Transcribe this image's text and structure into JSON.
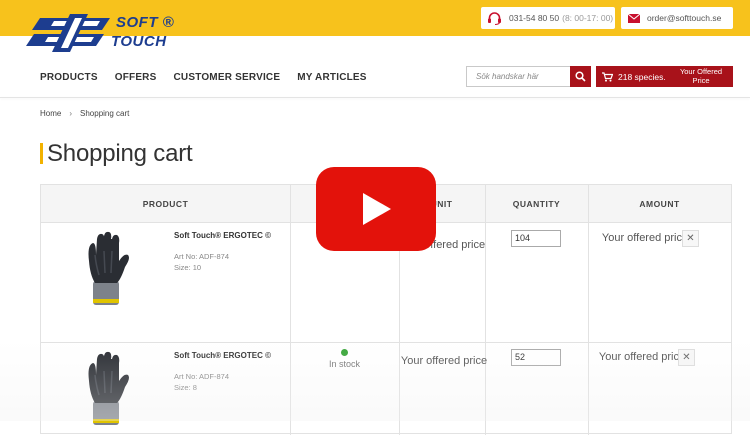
{
  "header": {
    "logo": {
      "line1": "SOFT ®",
      "line2": "TOUCH"
    },
    "phone": {
      "number": "031-54 80 50",
      "hours": "(8: 00-17: 00)"
    },
    "email": "order@softtouch.se"
  },
  "nav": {
    "items": [
      "PRODUCTS",
      "OFFERS",
      "CUSTOMER SERVICE",
      "MY ARTICLES"
    ]
  },
  "search": {
    "placeholder": "Sök handskar här"
  },
  "cart_button": {
    "label": "218 species.",
    "offer_label": "Your Offered Price"
  },
  "breadcrumb": {
    "home": "Home",
    "sep": "›",
    "current": "Shopping cart"
  },
  "page": {
    "title": "Shopping cart"
  },
  "table": {
    "headers": {
      "product": "PRODUCT",
      "unit": "UNIT",
      "quantity": "QUANTITY",
      "amount": "AMOUNT"
    },
    "rows": [
      {
        "name": "Soft Touch® ERGOTEC ©",
        "art_no": "Art No: ADF-874",
        "size": "Size: 10",
        "stock": "",
        "unit_price": "Your offered price",
        "quantity": "104",
        "amount": "Your offered price"
      },
      {
        "name": "Soft Touch® ERGOTEC ©",
        "art_no": "Art No: ADF-874",
        "size": "Size: 8",
        "stock": "In stock",
        "unit_price": "Your offered price",
        "quantity": "52",
        "amount": "Your offered price"
      }
    ]
  },
  "colors": {
    "topbar": "#f7c21c",
    "brand_blue": "#1d3d8f",
    "accent_red": "#a8121a",
    "youtube_red": "#e3120b",
    "title_accent": "#f2b200",
    "in_stock": "#3aa63a"
  },
  "icons": {
    "phone": "headset-icon",
    "email": "envelope-icon",
    "search": "search-icon",
    "cart": "cart-icon",
    "remove": "close-icon",
    "video": "play-icon"
  }
}
